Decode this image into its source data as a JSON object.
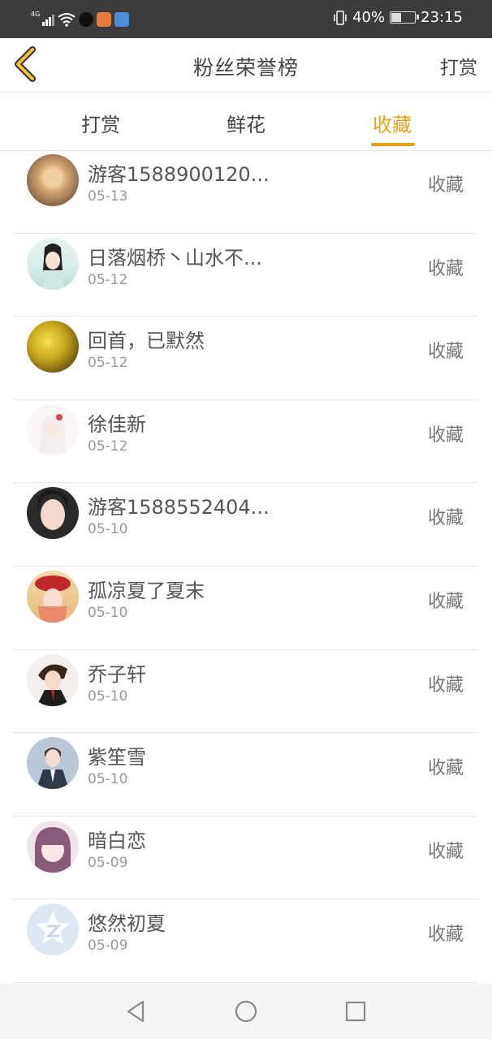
{
  "status_bar": {
    "network": "4G",
    "battery": "40%",
    "time": "23:15"
  },
  "header": {
    "title": "粉丝荣誉榜",
    "right_link": "打赏"
  },
  "tabs": [
    {
      "label": "打赏",
      "active": false
    },
    {
      "label": "鲜花",
      "active": false
    },
    {
      "label": "收藏",
      "active": true
    }
  ],
  "colors": {
    "accent": "#e8a317",
    "status_bar": "#3c3c3c"
  },
  "fans": [
    {
      "name": "游客1588900120...",
      "date": "05-13",
      "action": "收藏",
      "avatar": "cat-avatar"
    },
    {
      "name": "日落烟桥丶山水不...",
      "date": "05-12",
      "action": "收藏",
      "avatar": "ancient-girl-avatar"
    },
    {
      "name": "回首，已默然",
      "date": "05-12",
      "action": "收藏",
      "avatar": "golden-forest-avatar"
    },
    {
      "name": "徐佳新",
      "date": "05-12",
      "action": "收藏",
      "avatar": "white-hair-girl-avatar"
    },
    {
      "name": "游客1588552404...",
      "date": "05-10",
      "action": "收藏",
      "avatar": "girl-photo-avatar"
    },
    {
      "name": "孤凉夏了夏末",
      "date": "05-10",
      "action": "收藏",
      "avatar": "red-hat-girl-avatar"
    },
    {
      "name": "乔子轩",
      "date": "05-10",
      "action": "收藏",
      "avatar": "anime-boy-avatar"
    },
    {
      "name": "紫笙雪",
      "date": "05-10",
      "action": "收藏",
      "avatar": "suit-man-avatar"
    },
    {
      "name": "暗白恋",
      "date": "05-09",
      "action": "收藏",
      "avatar": "purple-hair-girl-avatar"
    },
    {
      "name": "悠然初夏",
      "date": "05-09",
      "action": "收藏",
      "avatar": "default-qq-avatar"
    }
  ]
}
